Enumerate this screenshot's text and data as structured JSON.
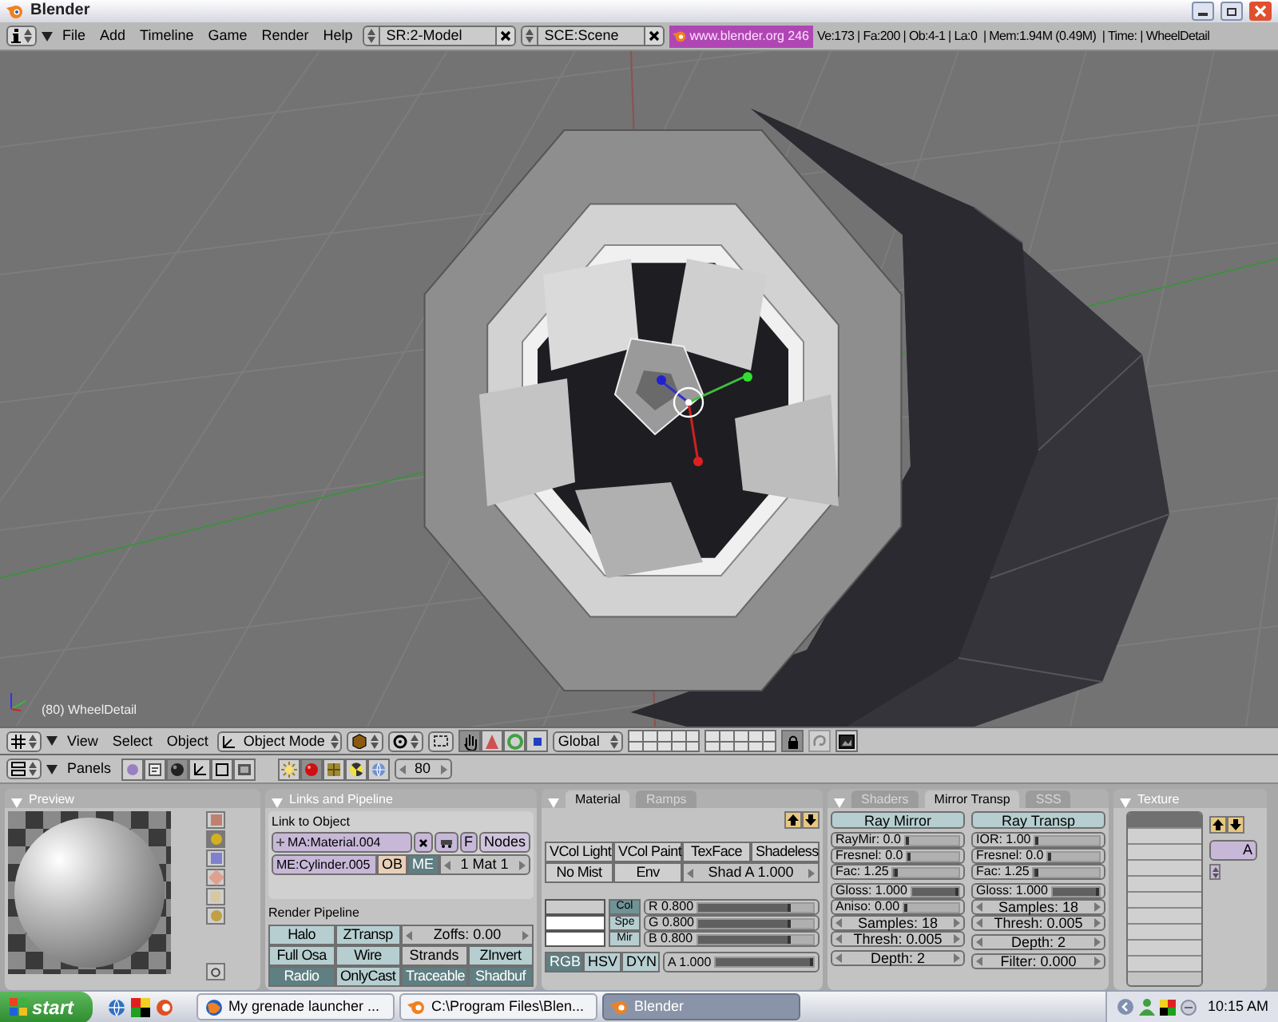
{
  "window": {
    "title": "Blender"
  },
  "info_header": {
    "menus": [
      "File",
      "Add",
      "Timeline",
      "Game",
      "Render",
      "Help"
    ],
    "screen": "SR:2-Model",
    "scene": "SCE:Scene",
    "version": "www.blender.org 246",
    "stats": "Ve:173 | Fa:200 | Ob:4-1 | La:0  | Mem:1.94M (0.49M)  | Time: | WheelDetail"
  },
  "viewport": {
    "object_label": "(80) WheelDetail"
  },
  "view3d_header": {
    "menus": [
      "View",
      "Select",
      "Object"
    ],
    "mode": "Object Mode",
    "orientation": "Global",
    "manipulators": [
      {
        "selected": true
      },
      {
        "selected": false
      },
      {
        "selected": false
      },
      {
        "selected": false
      }
    ],
    "lock_layers": true
  },
  "buttons_header": {
    "label": "Panels",
    "contexts": [
      {
        "selected": false
      },
      {
        "selected": false
      },
      {
        "selected": true
      },
      {
        "selected": false
      },
      {
        "selected": false
      },
      {
        "selected": false
      }
    ],
    "subcontexts": [
      {
        "selected": false
      },
      {
        "selected": true
      },
      {
        "selected": false
      },
      {
        "selected": false
      },
      {
        "selected": false
      }
    ],
    "frame": "80"
  },
  "panels": {
    "preview": {
      "title": "Preview",
      "types": [
        {
          "selected": false
        },
        {
          "selected": true
        },
        {
          "selected": false
        },
        {
          "selected": false
        },
        {
          "selected": false
        },
        {
          "selected": false
        }
      ]
    },
    "links": {
      "title": "Links and Pipeline",
      "link_label": "Link to Object",
      "material": "MA:Material.004",
      "fake_user": "F",
      "nodes": "Nodes",
      "mesh": "ME:Cylinder.005",
      "link_to": [
        {
          "label": "OB",
          "selected": false
        },
        {
          "label": "ME",
          "selected": true
        }
      ],
      "mat_index": "1 Mat 1",
      "pipeline_label": "Render Pipeline",
      "pipeline": [
        {
          "kind": "toggle",
          "label": "Halo",
          "on": false
        },
        {
          "kind": "toggle",
          "label": "ZTransp",
          "on": false
        },
        {
          "kind": "number",
          "label": "Zoffs: 0.00"
        },
        {
          "kind": "toggle",
          "label": "Full Osa",
          "on": false
        },
        {
          "kind": "toggle",
          "label": "Wire",
          "on": false
        },
        {
          "kind": "button",
          "label": "Strands"
        },
        {
          "kind": "toggle",
          "label": "ZInvert",
          "on": false
        },
        {
          "kind": "toggle",
          "label": "Radio",
          "on": true
        },
        {
          "kind": "toggle",
          "label": "OnlyCast",
          "on": false
        },
        {
          "kind": "toggle",
          "label": "Traceable",
          "on": true
        },
        {
          "kind": "toggle",
          "label": "Shadbuf",
          "on": true
        }
      ]
    },
    "material": {
      "tabs": [
        {
          "label": "Material",
          "selected": true
        },
        {
          "label": "Ramps",
          "selected": false
        }
      ],
      "toggles": [
        {
          "label": "VCol Light",
          "on": false
        },
        {
          "label": "VCol Paint",
          "on": false
        },
        {
          "label": "TexFace",
          "on": false
        },
        {
          "label": "Shadeless",
          "on": false
        },
        {
          "label": "No Mist",
          "on": false
        },
        {
          "label": "Env",
          "on": false
        }
      ],
      "shad_alpha": "Shad A 1.000",
      "colors": [
        {
          "label": "Col",
          "color": "#cccccc",
          "selected": true
        },
        {
          "label": "Spe",
          "color": "#ffffff",
          "selected": false
        },
        {
          "label": "Mir",
          "color": "#ffffff",
          "selected": false
        }
      ],
      "sliders": [
        {
          "label": "R 0.800",
          "level": 0.8
        },
        {
          "label": "G 0.800",
          "level": 0.8
        },
        {
          "label": "B 0.800",
          "level": 0.8
        }
      ],
      "models": [
        {
          "label": "RGB",
          "selected": true
        },
        {
          "label": "HSV",
          "selected": false
        },
        {
          "label": "DYN",
          "selected": false
        }
      ],
      "alpha": {
        "label": "A 1.000",
        "level": 1
      }
    },
    "shaders": {
      "tabs": [
        {
          "label": "Shaders",
          "selected": false
        },
        {
          "label": "Mirror Transp",
          "selected": true
        },
        {
          "label": "SSS",
          "selected": false
        }
      ],
      "columns": [
        {
          "toggle": {
            "label": "Ray Mirror",
            "on": false
          },
          "groups": [
            [
              {
                "kind": "slider",
                "label": "RayMir: 0.0",
                "level": 0
              },
              {
                "kind": "slider",
                "label": "Fresnel: 0.0",
                "level": 0
              },
              {
                "kind": "slider",
                "label": "Fac: 1.25",
                "level": 0.06
              }
            ],
            [
              {
                "kind": "slider",
                "label": "Gloss: 1.000",
                "level": 1
              },
              {
                "kind": "slider",
                "label": "Aniso: 0.00",
                "level": 0
              },
              {
                "kind": "number",
                "label": "Samples: 18"
              },
              {
                "kind": "number",
                "label": "Thresh: 0.005"
              }
            ],
            [
              {
                "kind": "number",
                "label": "Depth: 2"
              }
            ]
          ]
        },
        {
          "toggle": {
            "label": "Ray Transp",
            "on": false
          },
          "groups": [
            [
              {
                "kind": "slider",
                "label": "IOR: 1.00",
                "level": 0
              },
              {
                "kind": "slider",
                "label": "Fresnel: 0.0",
                "level": 0
              },
              {
                "kind": "slider",
                "label": "Fac: 1.25",
                "level": 0.06
              }
            ],
            [
              {
                "kind": "slider",
                "label": "Gloss: 1.000",
                "level": 1
              },
              {
                "kind": "number",
                "label": "Samples: 18"
              },
              {
                "kind": "number",
                "label": "Thresh: 0.005"
              }
            ],
            [
              {
                "kind": "number",
                "label": "Depth: 2"
              }
            ],
            [
              {
                "kind": "number",
                "label": "Filter: 0.000"
              }
            ]
          ]
        }
      ]
    },
    "texture": {
      "title": "Texture",
      "channels": [
        {
          "selected": true
        },
        {
          "selected": false
        },
        {
          "selected": false
        },
        {
          "selected": false
        },
        {
          "selected": false
        },
        {
          "selected": false
        },
        {
          "selected": false
        },
        {
          "selected": false
        },
        {
          "selected": false
        },
        {
          "selected": false
        }
      ],
      "add": "A"
    }
  },
  "taskbar": {
    "start": "start",
    "tasks": [
      {
        "label": "My grenade launcher ...",
        "selected": false
      },
      {
        "label": "C:\\Program Files\\Blen...",
        "selected": false
      },
      {
        "label": "Blender",
        "selected": true
      }
    ],
    "clock": "10:15 AM"
  }
}
